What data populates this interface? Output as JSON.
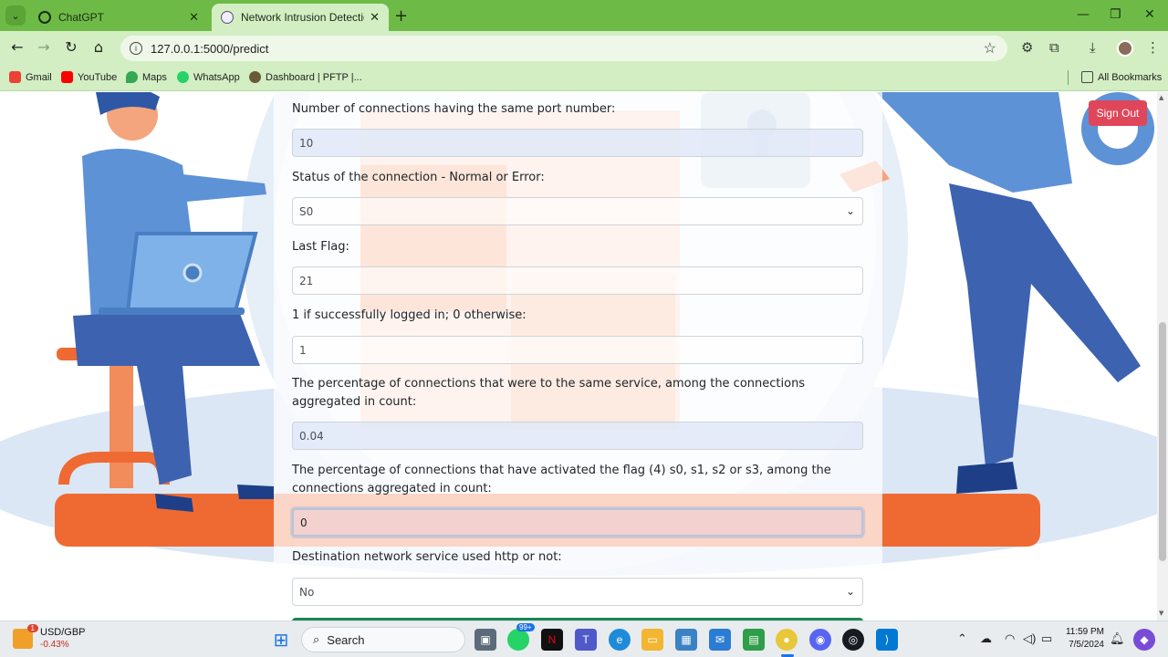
{
  "browser": {
    "tabs": [
      {
        "title": "ChatGPT",
        "active": false
      },
      {
        "title": "Network Intrusion Detection Sy",
        "active": true
      }
    ],
    "url": "127.0.0.1:5000/predict",
    "bookmarks": [
      {
        "label": "Gmail",
        "icon": "gmail-icon",
        "color": "#ea4335"
      },
      {
        "label": "YouTube",
        "icon": "youtube-icon",
        "color": "#ff0000"
      },
      {
        "label": "Maps",
        "icon": "maps-icon",
        "color": "#34a853"
      },
      {
        "label": "WhatsApp",
        "icon": "whatsapp-icon",
        "color": "#25d366"
      },
      {
        "label": "Dashboard | PFTP |...",
        "icon": "dashboard-icon",
        "color": "#6b5a3a"
      }
    ],
    "all_bookmarks_label": "All Bookmarks"
  },
  "page": {
    "signout_label": "Sign Out",
    "fields": [
      {
        "label": "Number of connections having the same port number:",
        "value": "10",
        "type": "input"
      },
      {
        "label": "Status of the connection - Normal or Error:",
        "value": "S0",
        "type": "select"
      },
      {
        "label": "Last Flag:",
        "value": "21",
        "type": "input"
      },
      {
        "label": "1 if successfully logged in; 0 otherwise:",
        "value": "1",
        "type": "input"
      },
      {
        "label": "The percentage of connections that were to the same service, among the connections aggregated in count:",
        "value": "0.04",
        "type": "input"
      },
      {
        "label": "The percentage of connections that have activated the flag (4) s0, s1, s2 or s3, among the connections aggregated in count:",
        "value": "0",
        "type": "input"
      },
      {
        "label": "Destination network service used http or not:",
        "value": "No",
        "type": "select"
      }
    ],
    "colors": {
      "signout": "#e0465a",
      "submit": "#198754",
      "accent_orange": "#ef6a33",
      "accent_blue": "#3b74c8"
    }
  },
  "taskbar": {
    "ticker_name": "USD/GBP",
    "ticker_change": "-0.43%",
    "ticker_badge": "1",
    "search_label": "Search",
    "whatsapp_badge": "99+",
    "time": "11:59 PM",
    "date": "7/5/2024"
  }
}
